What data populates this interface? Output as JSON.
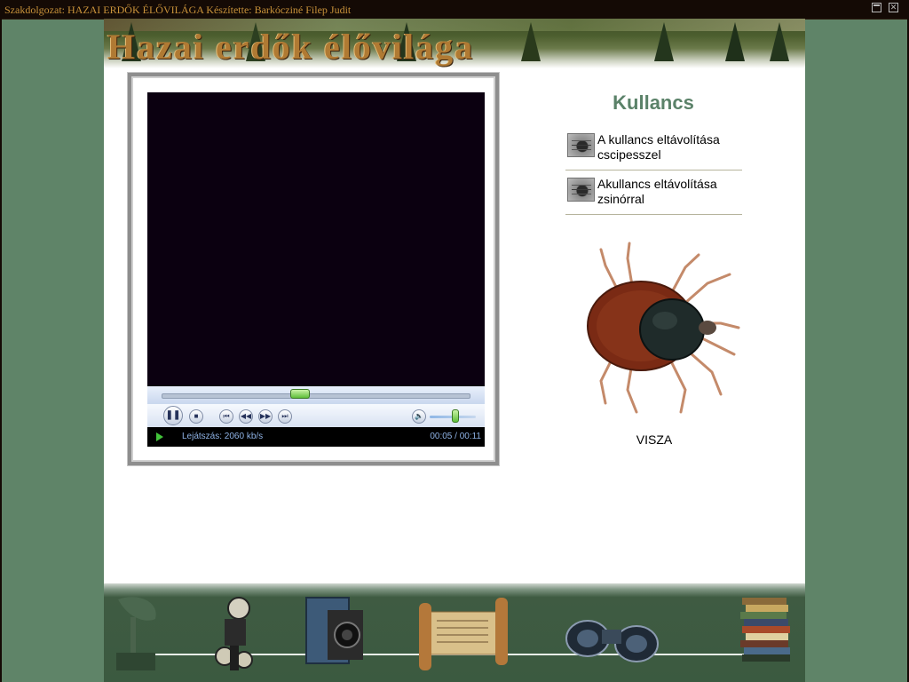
{
  "window": {
    "title": "Szakdolgozat: HAZAI ERDŐK ÉLŐVILÁGA Készítette: Barkócziné Filep Judit",
    "close_symbol": "✕"
  },
  "banner": {
    "title": "Hazai erdők élővilága"
  },
  "player": {
    "status_text": "Lejátszás: 2060 kb/s",
    "time": "00:05 / 00:11",
    "progress_fraction": 0.45,
    "volume_fraction": 0.55,
    "buttons": {
      "pause": "❚❚",
      "stop": "■",
      "prev": "⏮",
      "rewind": "◀◀",
      "forward": "▶▶",
      "next": "⏭",
      "mute": "🔈"
    }
  },
  "sidebar": {
    "title": "Kullancs",
    "links": [
      {
        "label": "A kullancs eltávolítása cscipesszel"
      },
      {
        "label": "Akullancs eltávolítása zsinórral"
      }
    ],
    "back_label": "VISZA"
  },
  "colors": {
    "background": "#5f8468",
    "title_bar": "#140a05",
    "title_text": "#c8923a",
    "topic_title": "#5b8269",
    "video_area": "#0b0010"
  },
  "bottom_icons": [
    "gramophone-icon",
    "film-projector-icon",
    "camera-icon",
    "scroll-icon",
    "binoculars-icon",
    "books-icon"
  ]
}
